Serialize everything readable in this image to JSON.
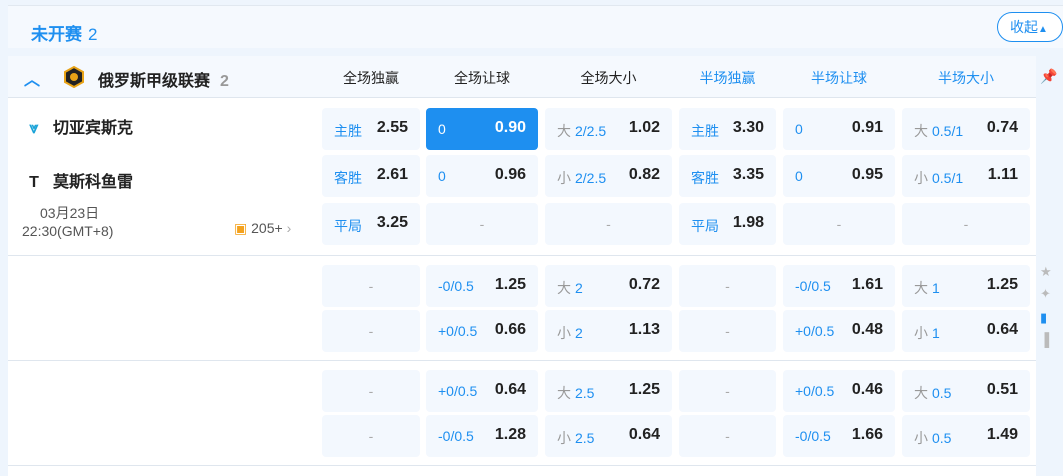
{
  "section": {
    "title": "未开赛",
    "count": "2",
    "collapse_label": "收起"
  },
  "league": {
    "name": "俄罗斯甲级联赛",
    "count": "2",
    "badge_icon": "league-badge-icon"
  },
  "columns": [
    {
      "label": "全场独赢",
      "half": false
    },
    {
      "label": "全场让球",
      "half": false
    },
    {
      "label": "全场大小",
      "half": false
    },
    {
      "label": "半场独赢",
      "half": true
    },
    {
      "label": "半场让球",
      "half": true
    },
    {
      "label": "半场大小",
      "half": true
    }
  ],
  "match": {
    "home": "切亚宾斯克",
    "away": "莫斯科鱼雷",
    "date": "03月23日",
    "time": "22:30(GMT+8)",
    "more": "205+"
  },
  "groups": [
    {
      "rows": [
        [
          {
            "line": "主胜",
            "odds": "2.55"
          },
          {
            "line": "0",
            "odds": "0.90",
            "hl": true
          },
          {
            "g": "大",
            "line": "2/2.5",
            "odds": "1.02"
          },
          {
            "line": "主胜",
            "odds": "3.30"
          },
          {
            "line": "0",
            "odds": "0.91"
          },
          {
            "g": "大",
            "line": "0.5/1",
            "odds": "0.74"
          }
        ],
        [
          {
            "line": "客胜",
            "odds": "2.61"
          },
          {
            "line": "0",
            "odds": "0.96"
          },
          {
            "g": "小",
            "line": "2/2.5",
            "odds": "0.82"
          },
          {
            "line": "客胜",
            "odds": "3.35"
          },
          {
            "line": "0",
            "odds": "0.95"
          },
          {
            "g": "小",
            "line": "0.5/1",
            "odds": "1.11"
          }
        ],
        [
          {
            "line": "平局",
            "odds": "3.25"
          },
          {
            "empty": "-"
          },
          {
            "empty": "-"
          },
          {
            "line": "平局",
            "odds": "1.98"
          },
          {
            "empty": "-"
          },
          {
            "empty": "-"
          }
        ]
      ]
    },
    {
      "rows": [
        [
          {
            "empty": "-"
          },
          {
            "line": "-0/0.5",
            "odds": "1.25"
          },
          {
            "g": "大",
            "line": "2",
            "odds": "0.72"
          },
          {
            "empty": "-"
          },
          {
            "line": "-0/0.5",
            "odds": "1.61"
          },
          {
            "g": "大",
            "line": "1",
            "odds": "1.25"
          }
        ],
        [
          {
            "empty": "-"
          },
          {
            "line": "+0/0.5",
            "odds": "0.66"
          },
          {
            "g": "小",
            "line": "2",
            "odds": "1.13"
          },
          {
            "empty": "-"
          },
          {
            "line": "+0/0.5",
            "odds": "0.48"
          },
          {
            "g": "小",
            "line": "1",
            "odds": "0.64"
          }
        ]
      ]
    },
    {
      "rows": [
        [
          {
            "empty": "-"
          },
          {
            "line": "+0/0.5",
            "odds": "0.64"
          },
          {
            "g": "大",
            "line": "2.5",
            "odds": "1.25"
          },
          {
            "empty": "-"
          },
          {
            "line": "+0/0.5",
            "odds": "0.46"
          },
          {
            "g": "大",
            "line": "0.5",
            "odds": "0.51"
          }
        ],
        [
          {
            "empty": "-"
          },
          {
            "line": "-0/0.5",
            "odds": "1.28"
          },
          {
            "g": "小",
            "line": "2.5",
            "odds": "0.64"
          },
          {
            "empty": "-"
          },
          {
            "line": "-0/0.5",
            "odds": "1.66"
          },
          {
            "g": "小",
            "line": "0.5",
            "odds": "1.49"
          }
        ]
      ]
    }
  ],
  "colors": {
    "accent": "#1e8ff0",
    "cell_bg": "#f3f8fe"
  }
}
